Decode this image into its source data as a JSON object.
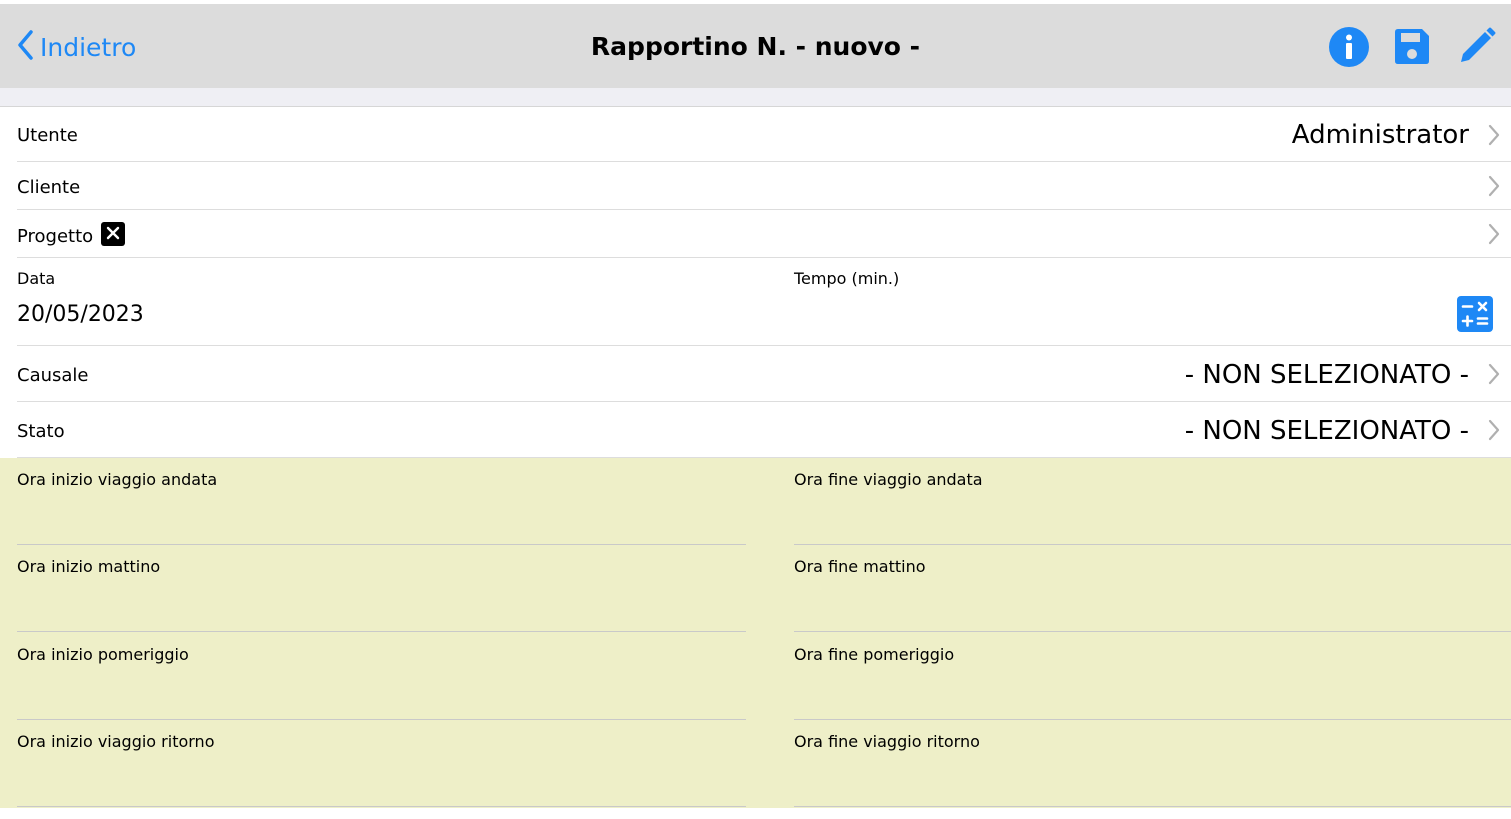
{
  "navbar": {
    "back_label": "Indietro",
    "title": "Rapportino N. - nuovo -",
    "info_icon": "info-circle-icon",
    "save_icon": "floppy-disk-icon",
    "edit_icon": "pencil-icon",
    "accent_color": "#1e88f5",
    "background_color": "#dcdcdc"
  },
  "form": {
    "utente": {
      "label": "Utente",
      "value": "Administrator"
    },
    "cliente": {
      "label": "Cliente",
      "value": ""
    },
    "progetto": {
      "label": "Progetto",
      "value": ""
    },
    "data": {
      "label": "Data",
      "value": "20/05/2023"
    },
    "tempo": {
      "label": "Tempo (min.)",
      "value": ""
    },
    "causale": {
      "label": "Causale",
      "value": "- NON SELEZIONATO -"
    },
    "stato": {
      "label": "Stato",
      "value": "- NON SELEZIONATO -"
    }
  },
  "times": {
    "background_color": "#eeefc8",
    "left": [
      {
        "label": "Ora inizio viaggio andata",
        "value": ""
      },
      {
        "label": "Ora inizio mattino",
        "value": ""
      },
      {
        "label": "Ora inizio pomeriggio",
        "value": ""
      },
      {
        "label": "Ora inizio viaggio ritorno",
        "value": ""
      }
    ],
    "right": [
      {
        "label": "Ora fine viaggio andata",
        "value": ""
      },
      {
        "label": "Ora fine mattino",
        "value": ""
      },
      {
        "label": "Ora fine pomeriggio",
        "value": ""
      },
      {
        "label": "Ora fine viaggio ritorno",
        "value": ""
      }
    ]
  }
}
